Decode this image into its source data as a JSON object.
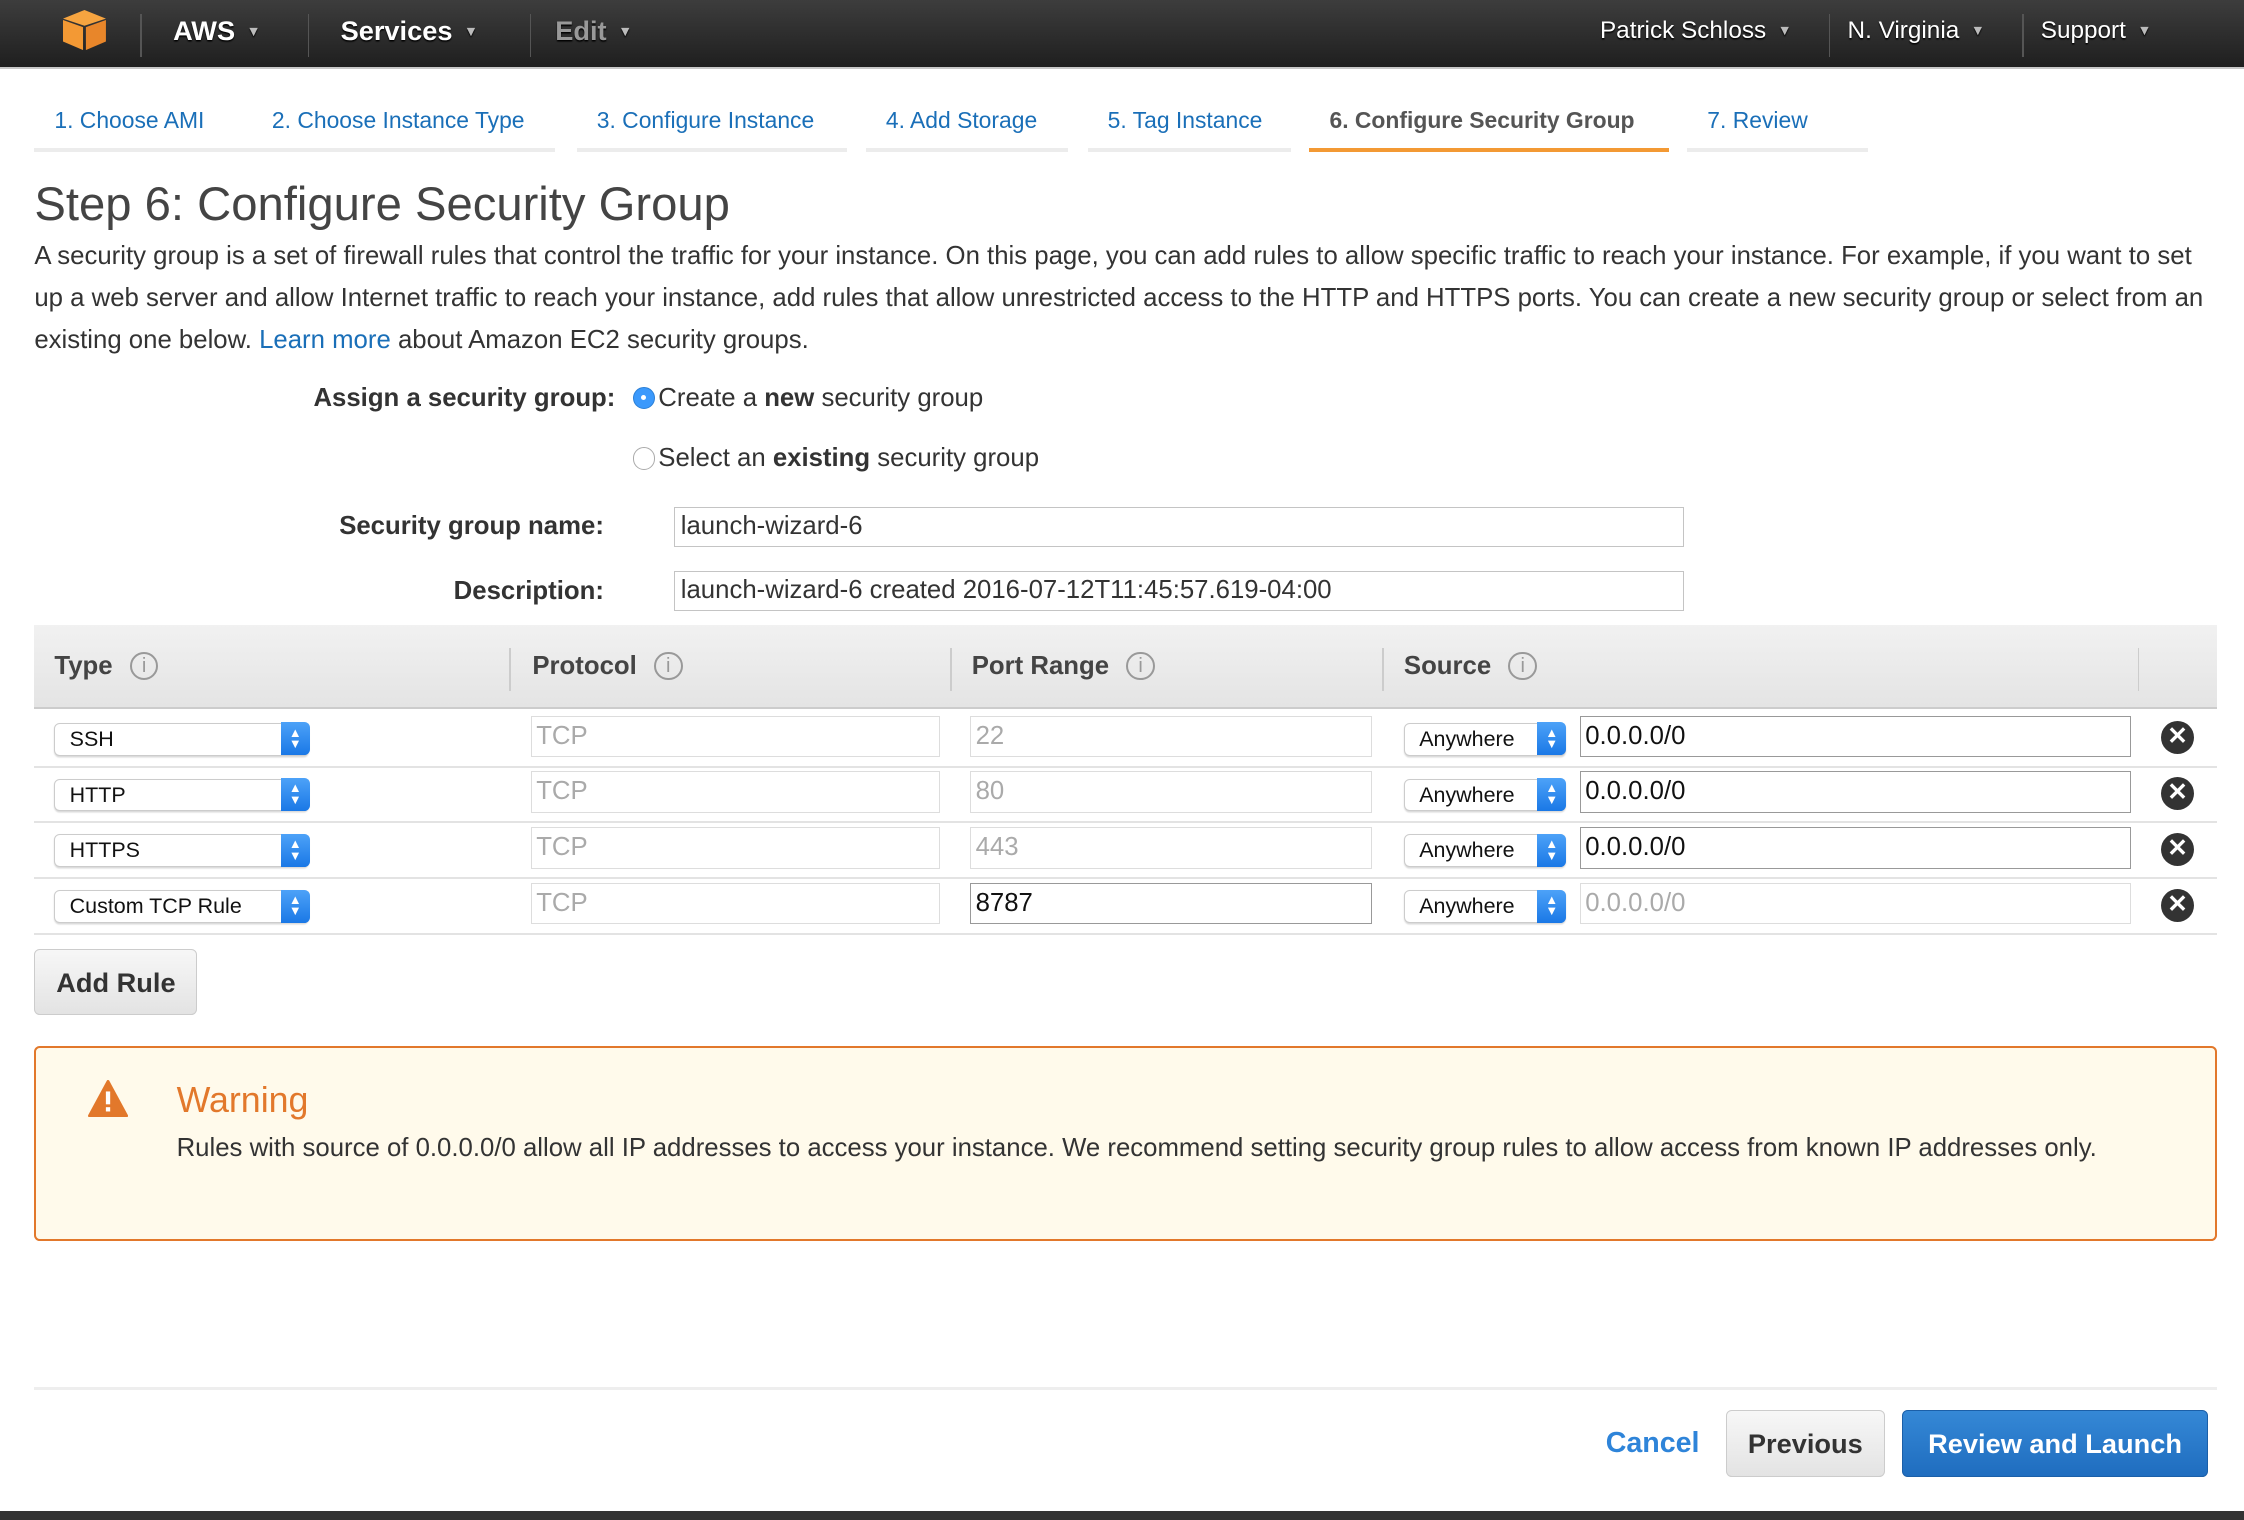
{
  "topbar": {
    "aws_label": "AWS",
    "services_label": "Services",
    "edit_label": "Edit",
    "user_label": "Patrick Schloss",
    "region_label": "N. Virginia",
    "support_label": "Support"
  },
  "wizard": {
    "tabs": [
      {
        "label": "1. Choose AMI"
      },
      {
        "label": "2. Choose Instance Type"
      },
      {
        "label": "3. Configure Instance"
      },
      {
        "label": "4. Add Storage"
      },
      {
        "label": "5. Tag Instance"
      },
      {
        "label": "6. Configure Security Group",
        "active": true
      },
      {
        "label": "7. Review"
      }
    ]
  },
  "page": {
    "title": "Step 6: Configure Security Group",
    "intro_text": "A security group is a set of firewall rules that control the traffic for your instance. On this page, you can add rules to allow specific traffic to reach your instance. For example, if you want to set up a web server and allow Internet traffic to reach your instance, add rules that allow unrestricted access to the HTTP and HTTPS ports. You can create a new security group or select from an existing one below.",
    "learn_more": "Learn more",
    "intro_suffix": "about Amazon EC2 security groups."
  },
  "form": {
    "assign_label": "Assign a security group:",
    "option_new_pre": "Create a ",
    "option_new_bold": "new",
    "option_new_post": " security group",
    "option_existing_pre": "Select an ",
    "option_existing_bold": "existing",
    "option_existing_post": " security group",
    "selected_option": "new",
    "name_label": "Security group name:",
    "name_value": "launch-wizard-6",
    "description_label": "Description:",
    "description_value": "launch-wizard-6 created 2016-07-12T11:45:57.619-04:00"
  },
  "table": {
    "headers": {
      "type": "Type",
      "protocol": "Protocol",
      "port_range": "Port Range",
      "source": "Source"
    },
    "info_glyph": "i",
    "rows": [
      {
        "type": "SSH",
        "protocol": "TCP",
        "port": "22",
        "source_type": "Anywhere",
        "cidr": "0.0.0.0/0"
      },
      {
        "type": "HTTP",
        "protocol": "TCP",
        "port": "80",
        "source_type": "Anywhere",
        "cidr": "0.0.0.0/0"
      },
      {
        "type": "HTTPS",
        "protocol": "TCP",
        "port": "443",
        "source_type": "Anywhere",
        "cidr": "0.0.0.0/0"
      },
      {
        "type": "Custom TCP Rule",
        "protocol": "TCP",
        "port": "8787",
        "source_type": "Anywhere",
        "cidr": "0.0.0.0/0"
      }
    ],
    "select_arrows": "⌃⌄",
    "remove_glyph": "✕"
  },
  "add_rule_label": "Add Rule",
  "warning": {
    "title": "Warning",
    "text": "Rules with source of 0.0.0.0/0 allow all IP addresses to access your instance. We recommend setting security group rules to allow access from known IP addresses only.",
    "color": "#e2782b"
  },
  "footer": {
    "cancel_label": "Cancel",
    "previous_label": "Previous",
    "launch_label": "Review and Launch"
  },
  "colors": {
    "accent_orange": "#f39934",
    "link_blue": "#1a6fb8",
    "primary_button": "#1f6dbf"
  }
}
